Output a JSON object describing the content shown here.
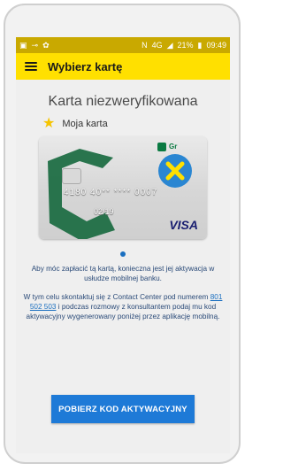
{
  "statusbar": {
    "icons_left": [
      "app-icon",
      "key-icon",
      "settings-icon"
    ],
    "nfc_label": "N",
    "network_label": "4G",
    "battery_percent": "21%",
    "time": "09:49"
  },
  "appbar": {
    "title": "Wybierz kartę"
  },
  "main": {
    "heading": "Karta niezweryfikowana",
    "card_name": "Moja karta",
    "card": {
      "bank_logo_text": "Gr",
      "number_masked": "4180 40** **** 0007",
      "expiry": "02/19",
      "network": "VISA"
    },
    "pager_dots": 1,
    "paragraph1": "Aby móc zapłacić tą kartą, konieczna jest jej aktywacja w usłudze mobilnej banku.",
    "paragraph2_prefix": "W tym celu skontaktuj się z Contact Center pod numerem ",
    "phone_number": "801 502 503",
    "paragraph2_suffix": " i podczas rozmowy z konsultantem podaj mu kod aktywacyjny wygenerowany poniżej przez aplikację mobilną.",
    "cta_label": "POBIERZ KOD AKTYWACYJNY"
  },
  "colors": {
    "appbar": "#ffe000",
    "statusbar": "#c9a900",
    "cta": "#1e7ad7",
    "badge": "#2a86d2",
    "badge_x": "#ffe000",
    "text_blue": "#2a4a78"
  }
}
